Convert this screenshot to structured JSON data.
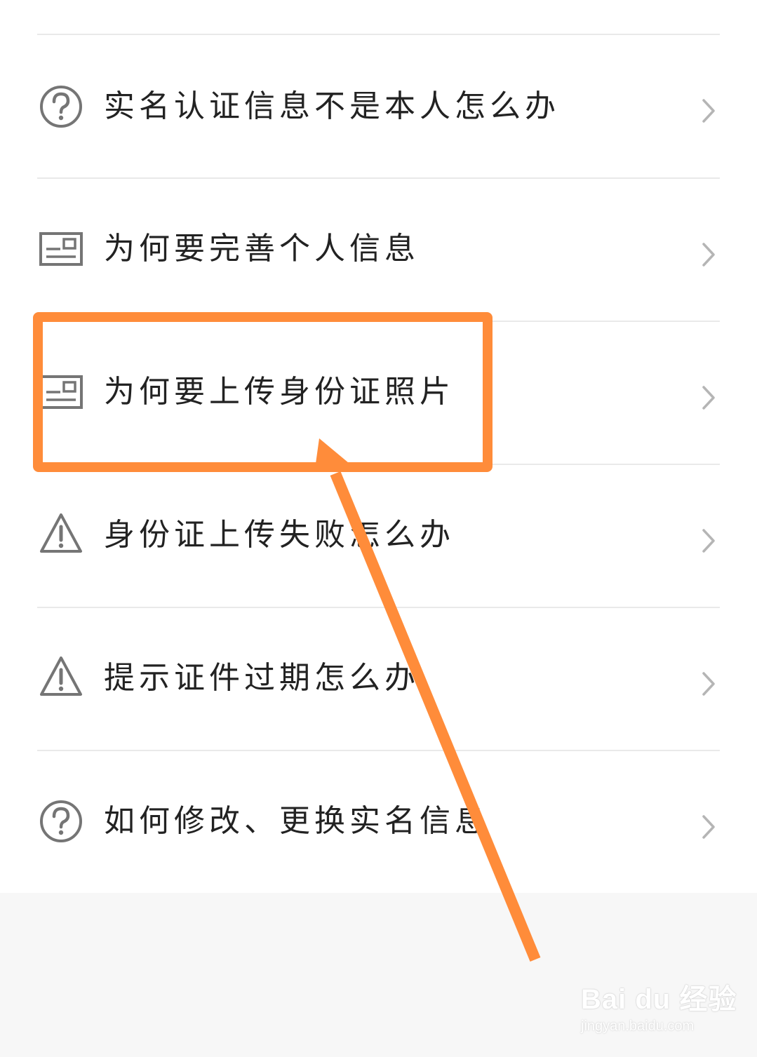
{
  "colors": {
    "accent_annotation": "#ff8c3a",
    "icon_gray": "#757575",
    "divider": "#e9e9e9",
    "footer_bg": "#f7f7f7"
  },
  "faq": {
    "items": [
      {
        "icon": "question-circle-icon",
        "label": "实名认证信息不是本人怎么办"
      },
      {
        "icon": "id-card-icon",
        "label": "为何要完善个人信息"
      },
      {
        "icon": "id-card-icon",
        "label": "为何要上传身份证照片"
      },
      {
        "icon": "warning-triangle-icon",
        "label": "身份证上传失败怎么办"
      },
      {
        "icon": "warning-triangle-icon",
        "label": "提示证件过期怎么办"
      },
      {
        "icon": "question-circle-icon",
        "label": "如何修改、更换实名信息"
      }
    ],
    "chevron_icon": "chevron-right-icon"
  },
  "annotation": {
    "highlighted_item": "为何要上传身份证照片",
    "arrow_icon": "arrow-up-left-icon"
  },
  "watermark": {
    "brand": "Bai du 经验",
    "url": "jingyan.baidu.com"
  }
}
